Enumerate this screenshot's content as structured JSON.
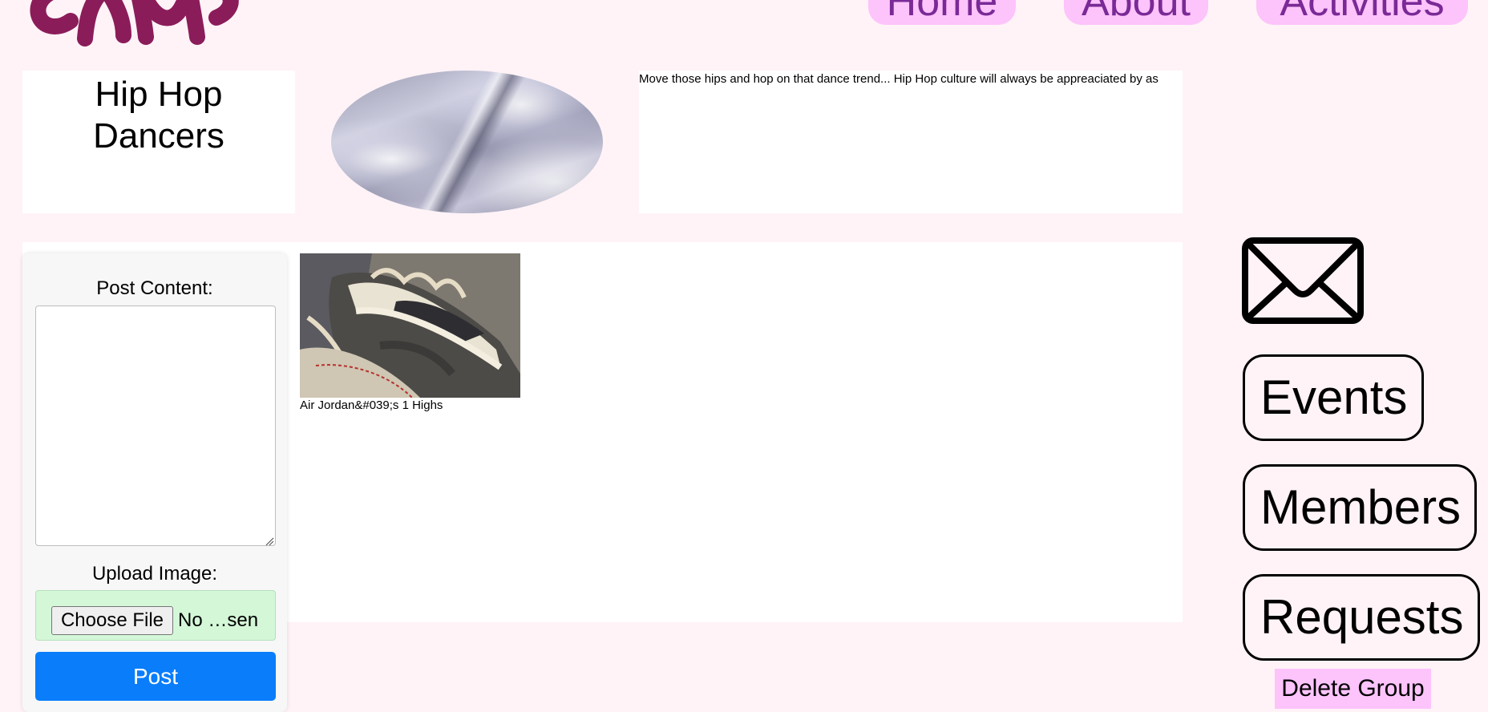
{
  "logo": {
    "icon": "camp-logo",
    "color": "#8b1c5a"
  },
  "nav": {
    "items": [
      {
        "label": "Home"
      },
      {
        "label": "About"
      },
      {
        "label": "Activities"
      }
    ],
    "bg_color": "#fdc3fb",
    "text_color": "#7a2a96"
  },
  "group": {
    "title_line1": "Hip Hop",
    "title_line2": "Dancers",
    "description": "Move those hips and hop on that dance trend... Hip Hop culture will always be appreaciated by as"
  },
  "post_form": {
    "content_label": "Post Content:",
    "content_value": "",
    "upload_label": "Upload Image:",
    "file_button_label": "Choose File",
    "file_status": "No …sen",
    "submit_label": "Post",
    "submit_color": "#0a7dfb"
  },
  "posts": [
    {
      "caption": "Air Jordan&#039;s 1 Highs"
    }
  ],
  "sidebar": {
    "mail_icon": "envelope-icon",
    "buttons": [
      {
        "label": "Events"
      },
      {
        "label": "Members"
      },
      {
        "label": "Requests"
      }
    ],
    "delete_label": "Delete Group"
  }
}
